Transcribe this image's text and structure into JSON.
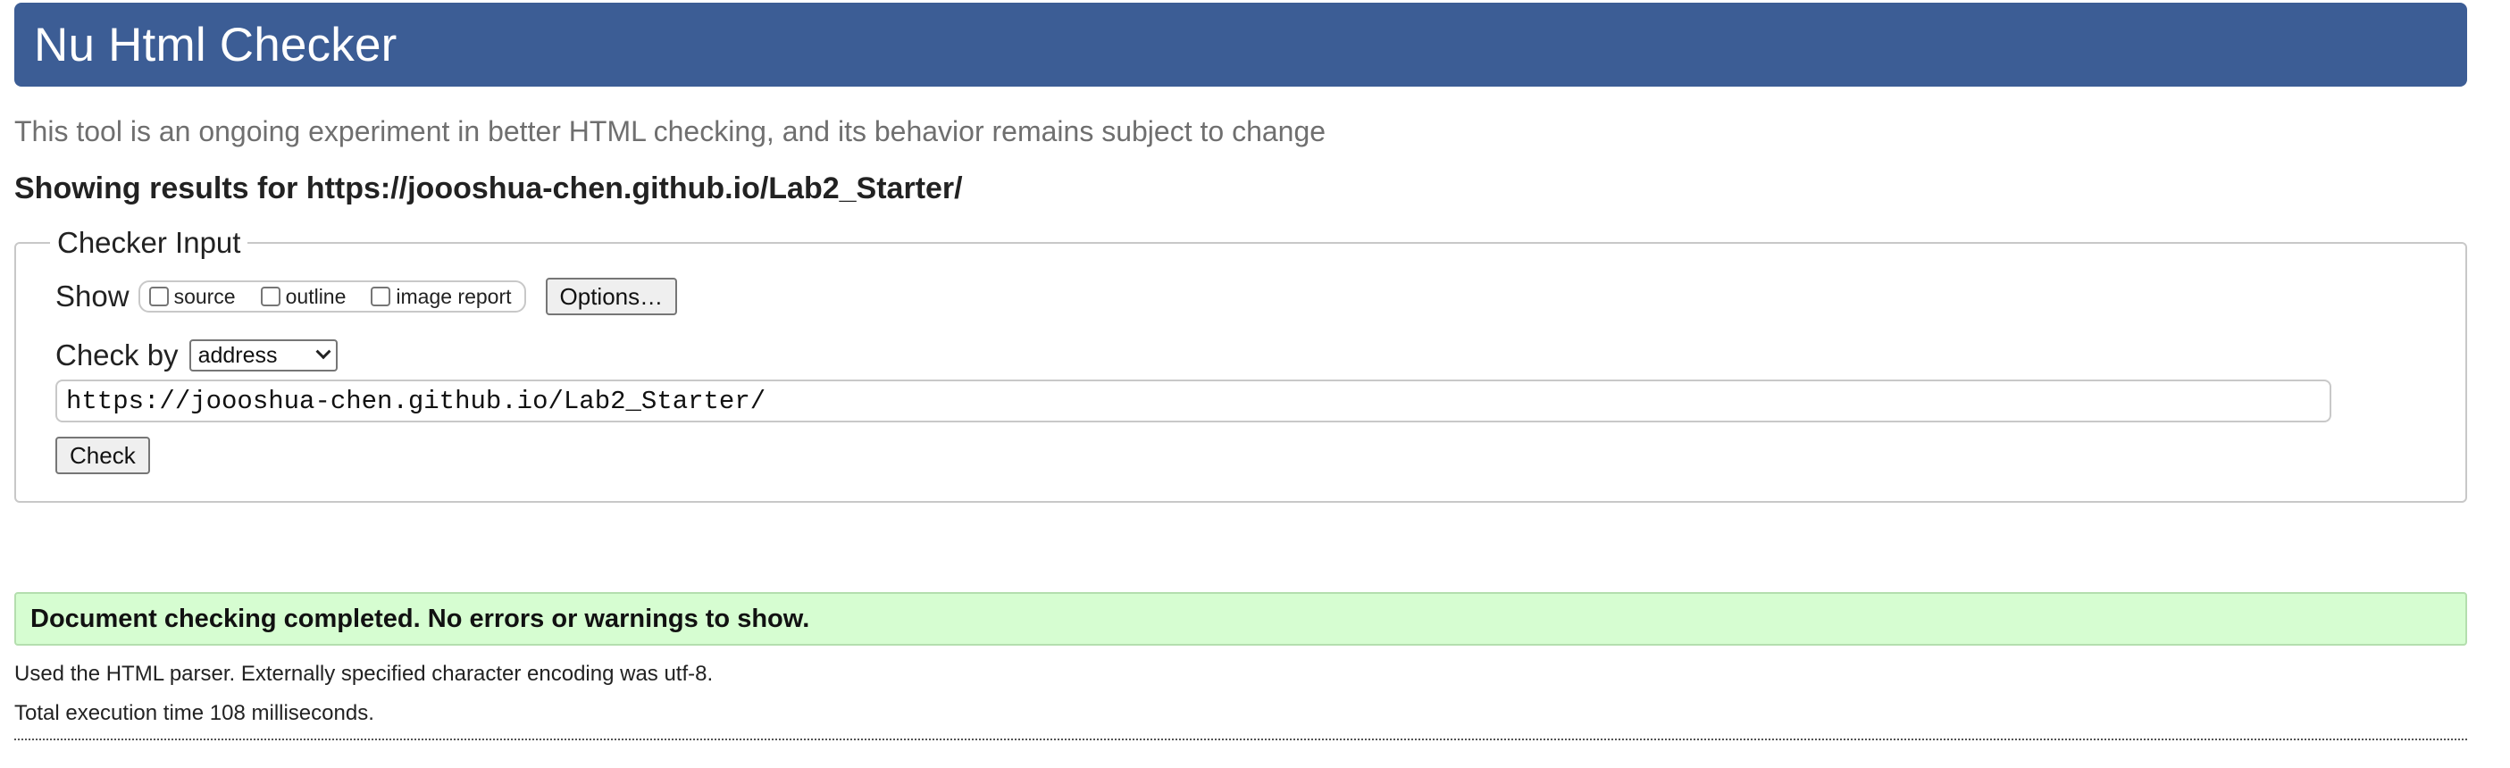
{
  "header": {
    "title": "Nu Html Checker"
  },
  "intro_text": "This tool is an ongoing experiment in better HTML checking, and its behavior remains subject to change",
  "showing_results": "Showing results for https://joooshua-chen.github.io/Lab2_Starter/",
  "checker_input": {
    "legend": "Checker Input",
    "show_label": "Show",
    "show_options": [
      {
        "label": "source",
        "checked": false
      },
      {
        "label": "outline",
        "checked": false
      },
      {
        "label": "image report",
        "checked": false
      }
    ],
    "options_button": "Options…",
    "check_by_label": "Check by",
    "check_by_selected": "address",
    "url_value": "https://joooshua-chen.github.io/Lab2_Starter/",
    "check_button": "Check"
  },
  "result": {
    "message": "Document checking completed. No errors or warnings to show."
  },
  "meta": {
    "parser_info": "Used the HTML parser. Externally specified character encoding was utf-8.",
    "execution_time": "Total execution time 108 milliseconds."
  },
  "colors": {
    "header_bg": "#3c5d95",
    "success_bg": "#d6fdd1"
  }
}
